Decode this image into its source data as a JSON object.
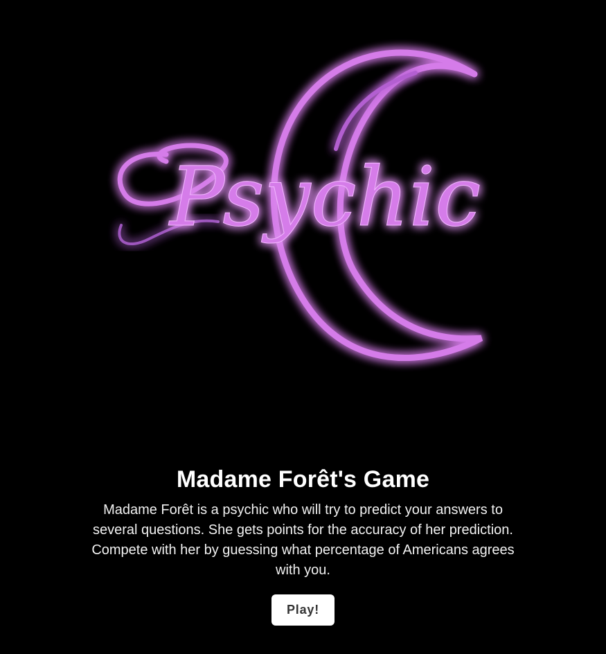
{
  "hero": {
    "neon_text": "Psychic",
    "neon_color": "#d57be9",
    "glow_color": "#a64cc8"
  },
  "game": {
    "title": "Madame Forêt's Game",
    "description": "Madame Forêt is a psychic who will try to predict your answers to several questions. She gets points for the accuracy of her prediction. Compete with her by guessing what percentage of Americans agrees with you.",
    "play_label": "Play!"
  },
  "colors": {
    "background": "#000000",
    "text": "#ffffff",
    "button_background": "#ffffff",
    "button_text": "#333333"
  }
}
